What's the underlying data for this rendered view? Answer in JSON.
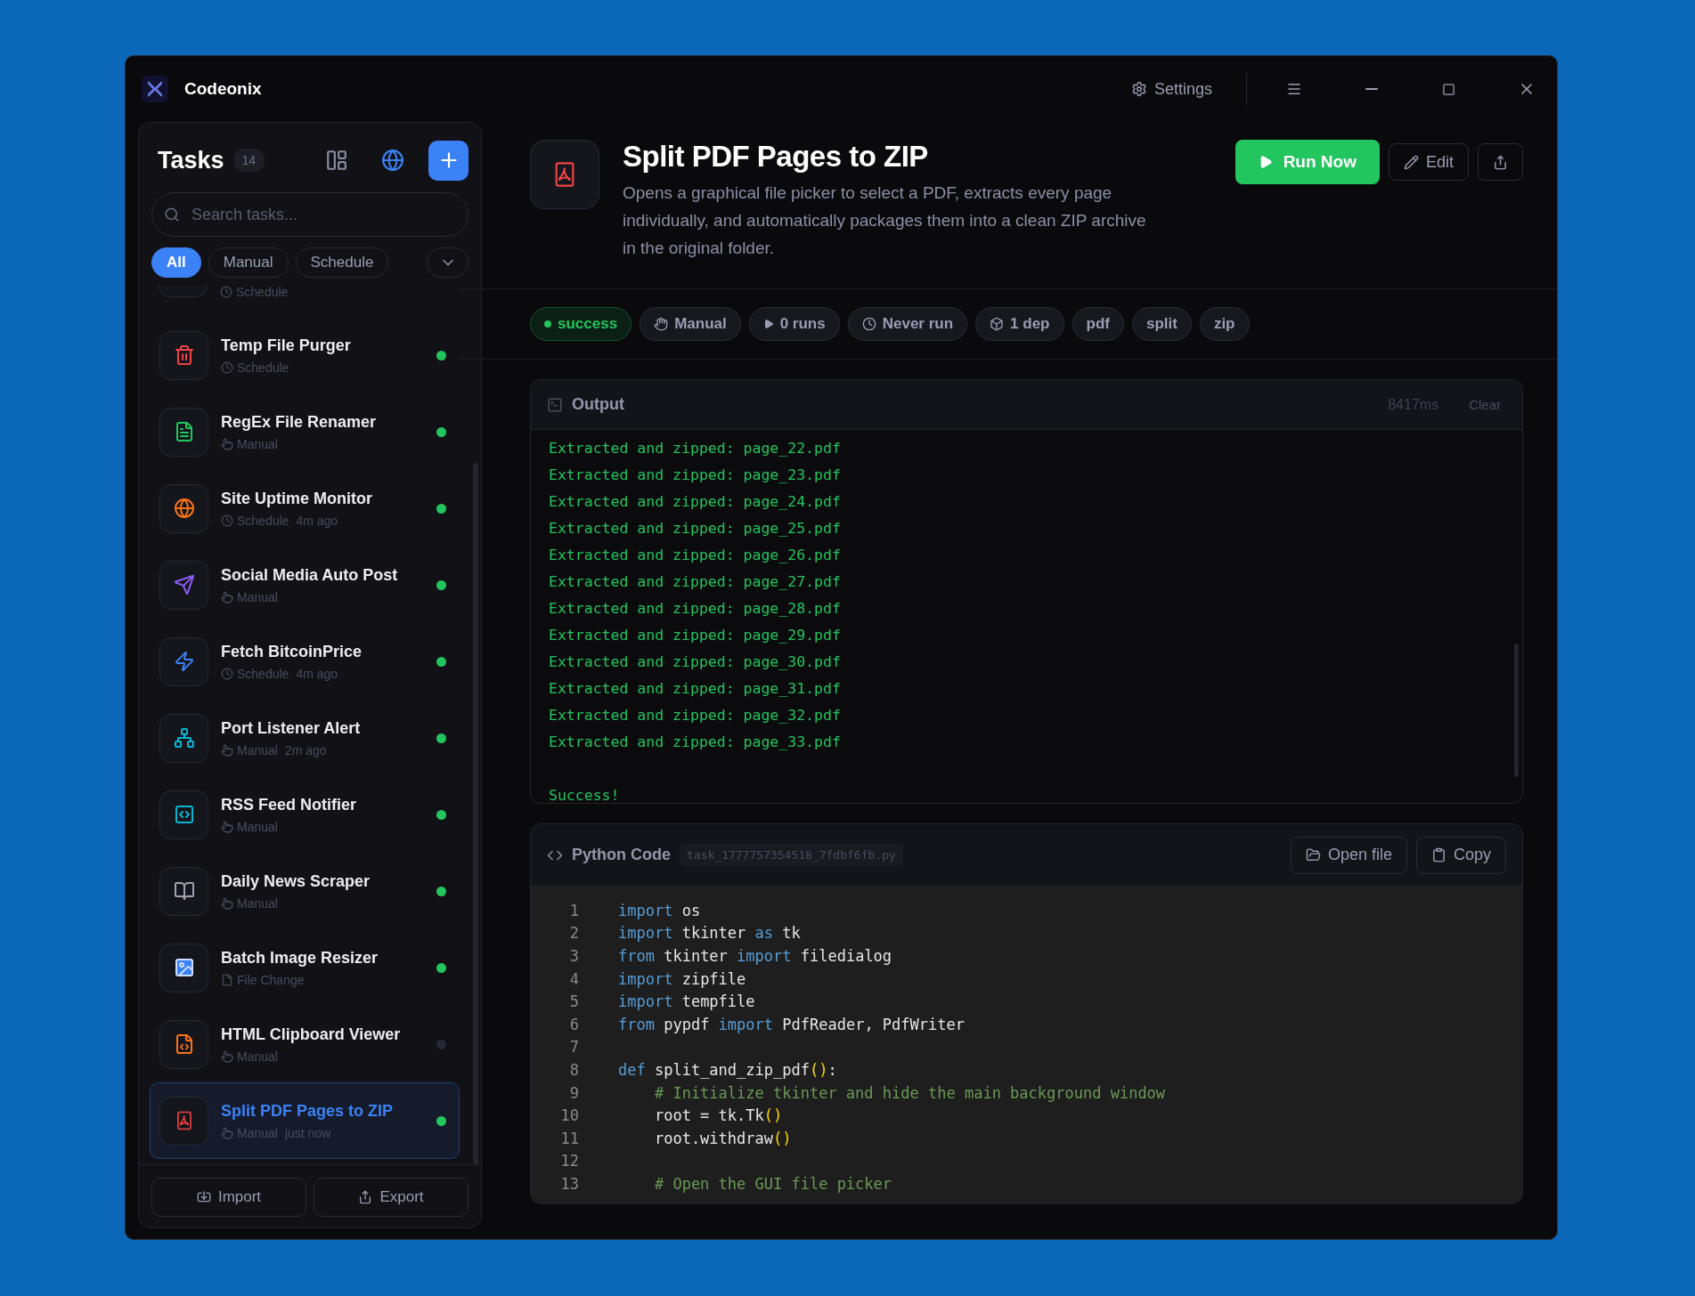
{
  "app": {
    "title": "Codeonix",
    "settings": "Settings"
  },
  "sidebar": {
    "title": "Tasks",
    "count": "14",
    "search": {
      "placeholder": "Search tasks..."
    },
    "filters": [
      {
        "label": "All",
        "selected": true
      },
      {
        "label": "Manual",
        "selected": false
      },
      {
        "label": "Schedule",
        "selected": false
      }
    ],
    "items": [
      {
        "kind": "partial",
        "trigger": {
          "kind": "schedule",
          "label": "Schedule"
        }
      },
      {
        "kind": "trash",
        "name": "Temp File Purger",
        "color": "#ef4444",
        "trigger": {
          "kind": "schedule",
          "label": "Schedule"
        },
        "active": true,
        "selected": false
      },
      {
        "kind": "document",
        "name": "RegEx File Renamer",
        "color": "#22c55e",
        "trigger": {
          "kind": "manual",
          "label": "Manual"
        },
        "active": true,
        "selected": false
      },
      {
        "kind": "globe",
        "name": "Site Uptime Monitor",
        "color": "#f97316",
        "trigger": {
          "kind": "schedule",
          "label": "Schedule"
        },
        "ago": "4m ago",
        "active": true,
        "selected": false
      },
      {
        "kind": "send",
        "name": "Social Media Auto Post",
        "color": "#8b5cf6",
        "trigger": {
          "kind": "manual",
          "label": "Manual"
        },
        "active": true,
        "selected": false
      },
      {
        "kind": "bolt",
        "name": "Fetch BitcoinPrice",
        "color": "#3b82f6",
        "trigger": {
          "kind": "schedule",
          "label": "Schedule"
        },
        "ago": "4m ago",
        "active": true,
        "selected": false
      },
      {
        "kind": "network",
        "name": "Port Listener Alert",
        "color": "#06b6d4",
        "trigger": {
          "kind": "manual",
          "label": "Manual"
        },
        "ago": "2m ago",
        "active": true,
        "selected": false
      },
      {
        "kind": "code",
        "name": "RSS Feed Notifier",
        "color": "#06b6d4",
        "trigger": {
          "kind": "manual",
          "label": "Manual"
        },
        "active": true,
        "selected": false
      },
      {
        "kind": "book",
        "name": "Daily News Scraper",
        "color": "#9ca3af",
        "trigger": {
          "kind": "manual",
          "label": "Manual"
        },
        "active": true,
        "selected": false
      },
      {
        "kind": "image",
        "name": "Batch Image Resizer",
        "color": "#3b82f6",
        "trigger": {
          "kind": "file",
          "label": "File Change"
        },
        "active": true,
        "selected": false
      },
      {
        "kind": "filecode",
        "name": "HTML Clipboard Viewer",
        "color": "#f97316",
        "trigger": {
          "kind": "manual",
          "label": "Manual"
        },
        "active": false,
        "selected": false
      },
      {
        "kind": "pdf",
        "name": "Split PDF Pages to ZIP",
        "color": "#ef4444",
        "trigger": {
          "kind": "manual",
          "label": "Manual"
        },
        "ago": "just now",
        "active": true,
        "selected": true
      }
    ],
    "import": "Import",
    "export": "Export"
  },
  "task": {
    "title": "Split PDF Pages to ZIP",
    "description": "Opens a graphical file picker to select a PDF, extracts every page individually, and automatically packages them into a clean ZIP archive in the original folder.",
    "run": "Run Now",
    "edit": "Edit",
    "chips": [
      {
        "kind": "status",
        "label": "success"
      },
      {
        "kind": "manual",
        "label": "Manual"
      },
      {
        "kind": "runs",
        "label": "0 runs"
      },
      {
        "kind": "time",
        "label": "Never run"
      },
      {
        "kind": "deps",
        "label": "1 dep"
      },
      {
        "kind": "tag",
        "label": "pdf"
      },
      {
        "kind": "tag",
        "label": "split"
      },
      {
        "kind": "tag",
        "label": "zip"
      }
    ]
  },
  "output": {
    "title": "Output",
    "duration": "8417ms",
    "clear": "Clear",
    "lines": [
      "Extracted and zipped: page_22.pdf",
      "Extracted and zipped: page_23.pdf",
      "Extracted and zipped: page_24.pdf",
      "Extracted and zipped: page_25.pdf",
      "Extracted and zipped: page_26.pdf",
      "Extracted and zipped: page_27.pdf",
      "Extracted and zipped: page_28.pdf",
      "Extracted and zipped: page_29.pdf",
      "Extracted and zipped: page_30.pdf",
      "Extracted and zipped: page_31.pdf",
      "Extracted and zipped: page_32.pdf",
      "Extracted and zipped: page_33.pdf"
    ],
    "result": "Success!"
  },
  "code": {
    "title": "Python Code",
    "file": "task_1777757354518_7fdbf6fb.py",
    "open": "Open file",
    "copy": "Copy",
    "lines": [
      {
        "number": "1",
        "tokens": [
          {
            "kind": "kw",
            "text": "import"
          },
          {
            "kind": "plain",
            "text": " os"
          }
        ]
      },
      {
        "number": "2",
        "tokens": [
          {
            "kind": "kw",
            "text": "import"
          },
          {
            "kind": "plain",
            "text": " tkinter "
          },
          {
            "kind": "kw",
            "text": "as"
          },
          {
            "kind": "plain",
            "text": " tk"
          }
        ]
      },
      {
        "number": "3",
        "tokens": [
          {
            "kind": "kw",
            "text": "from"
          },
          {
            "kind": "plain",
            "text": " tkinter "
          },
          {
            "kind": "kw",
            "text": "import"
          },
          {
            "kind": "plain",
            "text": " filedialog"
          }
        ]
      },
      {
        "number": "4",
        "tokens": [
          {
            "kind": "kw",
            "text": "import"
          },
          {
            "kind": "plain",
            "text": " zipfile"
          }
        ]
      },
      {
        "number": "5",
        "tokens": [
          {
            "kind": "kw",
            "text": "import"
          },
          {
            "kind": "plain",
            "text": " tempfile"
          }
        ]
      },
      {
        "number": "6",
        "tokens": [
          {
            "kind": "kw",
            "text": "from"
          },
          {
            "kind": "plain",
            "text": " pypdf "
          },
          {
            "kind": "kw",
            "text": "import"
          },
          {
            "kind": "plain",
            "text": " PdfReader, PdfWriter"
          }
        ]
      },
      {
        "number": "7"
      },
      {
        "number": "8",
        "tokens": [
          {
            "kind": "kw",
            "text": "def"
          },
          {
            "kind": "plain",
            "text": " split_and_zip_pdf"
          },
          {
            "kind": "paren",
            "text": "()"
          },
          {
            "kind": "plain",
            "text": ":"
          }
        ]
      },
      {
        "number": "9",
        "tokens": [
          {
            "kind": "comment",
            "text": "    # Initialize tkinter and hide the main background window"
          }
        ]
      },
      {
        "number": "10",
        "tokens": [
          {
            "kind": "plain",
            "text": "    root = tk.Tk"
          },
          {
            "kind": "paren",
            "text": "()"
          }
        ]
      },
      {
        "number": "11",
        "tokens": [
          {
            "kind": "plain",
            "text": "    root.withdraw"
          },
          {
            "kind": "paren",
            "text": "()"
          }
        ]
      },
      {
        "number": "12"
      },
      {
        "number": "13",
        "tokens": [
          {
            "kind": "comment",
            "text": "    # Open the GUI file picker"
          }
        ]
      }
    ]
  }
}
